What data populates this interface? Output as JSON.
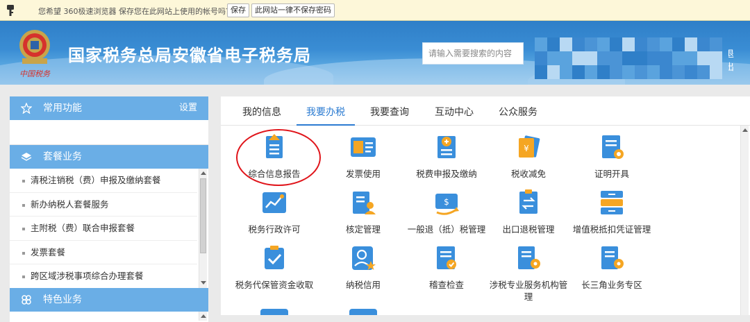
{
  "browser_prompt": {
    "message": "您希望 360极速浏览器 保存您在此网站上使用的帐号吗？",
    "save_label": "保存",
    "never_label": "此网站一律不保存密码"
  },
  "header": {
    "site_title": "国家税务总局安徽省电子税务局",
    "emblem_text": "中国税务",
    "search_placeholder": "请输入需要搜索的内容",
    "logout_fragment": "退出"
  },
  "sidebar": {
    "common": {
      "label": "常用功能",
      "settings_label": "设置"
    },
    "packages": {
      "label": "套餐业务",
      "items": [
        {
          "label": "清税注销税（费）申报及缴纳套餐"
        },
        {
          "label": "新办纳税人套餐服务"
        },
        {
          "label": "主附税（费）联合申报套餐"
        },
        {
          "label": "发票套餐"
        },
        {
          "label": "跨区域涉税事项综合办理套餐"
        }
      ]
    },
    "special": {
      "label": "特色业务"
    }
  },
  "tabs": [
    {
      "label": "我的信息",
      "active": false
    },
    {
      "label": "我要办税",
      "active": true
    },
    {
      "label": "我要查询",
      "active": false
    },
    {
      "label": "互动中心",
      "active": false
    },
    {
      "label": "公众服务",
      "active": false
    }
  ],
  "services": [
    {
      "label": "综合信息报告",
      "icon": "report-upload-icon"
    },
    {
      "label": "发票使用",
      "icon": "invoice-icon"
    },
    {
      "label": "税费申报及缴纳",
      "icon": "declare-plus-icon"
    },
    {
      "label": "税收减免",
      "icon": "tax-relief-icon"
    },
    {
      "label": "证明开具",
      "icon": "certificate-icon"
    },
    {
      "label": "税务行政许可",
      "icon": "permit-chart-icon"
    },
    {
      "label": "核定管理",
      "icon": "approval-person-icon"
    },
    {
      "label": "一般退（抵）税管理",
      "icon": "refund-arrow-icon"
    },
    {
      "label": "出口退税管理",
      "icon": "export-refund-icon"
    },
    {
      "label": "增值税抵扣凭证管理",
      "icon": "vat-deduction-icon"
    },
    {
      "label": "税务代保管资金收取",
      "icon": "custody-check-icon"
    },
    {
      "label": "纳税信用",
      "icon": "credit-person-icon"
    },
    {
      "label": "稽查检查",
      "icon": "inspection-icon"
    },
    {
      "label": "涉税专业服务机构管理",
      "icon": "agency-gear-icon"
    },
    {
      "label": "长三角业务专区",
      "icon": "yangtze-gear-icon"
    }
  ],
  "colors": {
    "accent": "#2b7bd1",
    "sidebar_header": "#6aaee6",
    "banner": "#3a8dd4",
    "prompt_bar": "#fdf7d9",
    "highlight_ring": "#e0151b",
    "icon_blue": "#3a8fdc",
    "icon_orange": "#f5a623"
  }
}
